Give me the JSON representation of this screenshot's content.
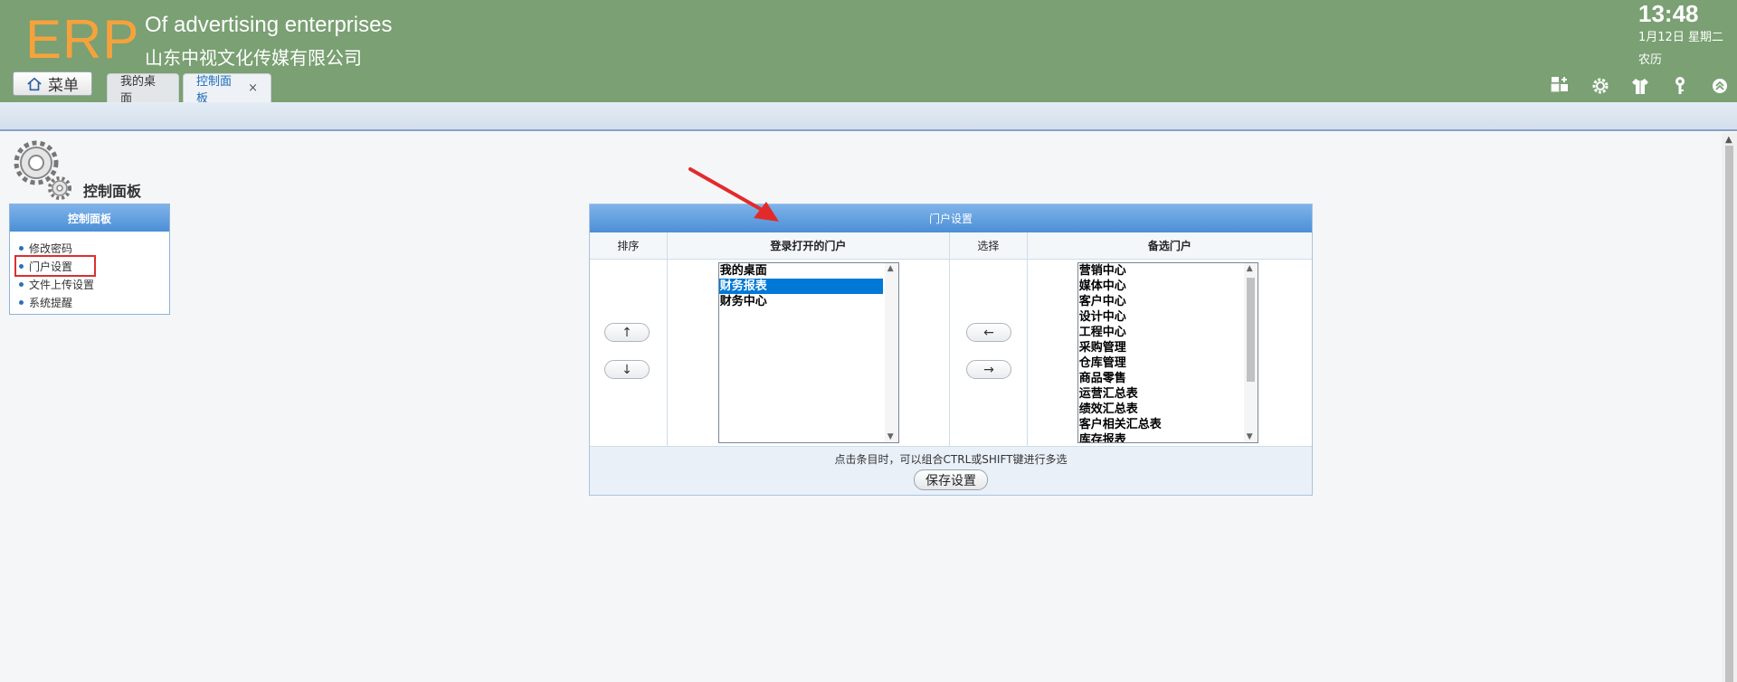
{
  "header": {
    "logo": "ERP",
    "tagline": "Of advertising enterprises",
    "company": "山东中视文化传媒有限公司",
    "clock": "13:48",
    "date": "1月12日 星期二",
    "lunar": "农历",
    "menu_label": "菜单",
    "tabs": [
      {
        "label": "我的桌面"
      },
      {
        "label": "控制面板",
        "close": "×"
      }
    ],
    "tool_icons": [
      "add-widget-icon",
      "gear-icon",
      "shirt-icon",
      "key-icon",
      "collapse-up-icon"
    ]
  },
  "sidebar": {
    "page_title": "控制面板",
    "box_title": "控制面板",
    "items": [
      {
        "label": "修改密码"
      },
      {
        "label": "门户设置"
      },
      {
        "label": "文件上传设置"
      },
      {
        "label": "系统提醒"
      }
    ]
  },
  "portal": {
    "title": "门户设置",
    "columns": {
      "sort": "排序",
      "opened": "登录打开的门户",
      "select": "选择",
      "available": "备选门户"
    },
    "sort_up": "↑",
    "sort_down": "↓",
    "move_left": "←",
    "move_right": "→",
    "opened_items": [
      "我的桌面",
      "财务报表",
      "财务中心"
    ],
    "opened_selected": "财务报表",
    "available_items": [
      "营销中心",
      "媒体中心",
      "客户中心",
      "设计中心",
      "工程中心",
      "采购管理",
      "仓库管理",
      "商品零售",
      "运营汇总表",
      "绩效汇总表",
      "客户相关汇总表",
      "库存报表"
    ],
    "hint": "点击条目时，可以组合CTRL或SHIFT键进行多选",
    "save_label": "保存设置"
  },
  "colors": {
    "header_bg": "#7aa073",
    "logo": "#f6a23c",
    "panel_head": "#4b8fd6",
    "selected": "#0078d7",
    "highlight": "#d93030"
  }
}
